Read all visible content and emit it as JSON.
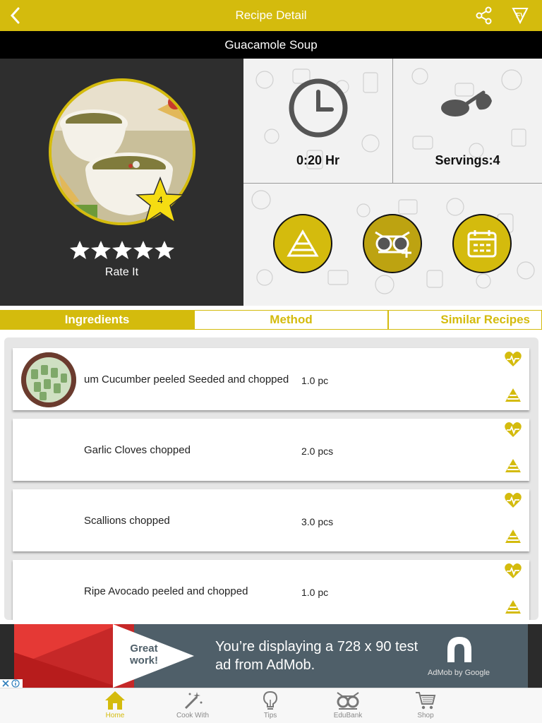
{
  "nav": {
    "title": "Recipe Detail"
  },
  "recipe": {
    "name": "Guacamole Soup",
    "rating_badge": "4",
    "rate_label": "Rate It"
  },
  "stats": {
    "time": "0:20 Hr",
    "servings": "Servings:4"
  },
  "tabs": [
    {
      "label": "Ingredients",
      "active": true
    },
    {
      "label": "Method",
      "active": false
    },
    {
      "label": "Similar Recipes",
      "active": false
    }
  ],
  "ingredients": [
    {
      "name": "um Cucumber peeled Seeded and chopped",
      "qty": "1.0 pc"
    },
    {
      "name": "Garlic Cloves chopped",
      "qty": "2.0 pcs"
    },
    {
      "name": "Scallions chopped",
      "qty": "3.0 pcs"
    },
    {
      "name": "Ripe Avocado peeled and chopped",
      "qty": "1.0 pc"
    }
  ],
  "ad": {
    "badge": "Great work!",
    "text": "You’re displaying a 728 x 90 test ad from AdMob.",
    "brand": "AdMob by Google"
  },
  "bottom_tabs": [
    {
      "label": "Home",
      "icon": "home-icon",
      "active": true
    },
    {
      "label": "Cook With",
      "icon": "magic-wand-icon",
      "active": false
    },
    {
      "label": "Tips",
      "icon": "lightbulb-icon",
      "active": false
    },
    {
      "label": "EduBank",
      "icon": "owl-glasses-icon",
      "active": false
    },
    {
      "label": "Shop",
      "icon": "cart-icon",
      "active": false
    }
  ],
  "colors": {
    "accent": "#d4bb0d",
    "dark": "#2e2e2e",
    "ad_bg": "#4f5f69"
  }
}
